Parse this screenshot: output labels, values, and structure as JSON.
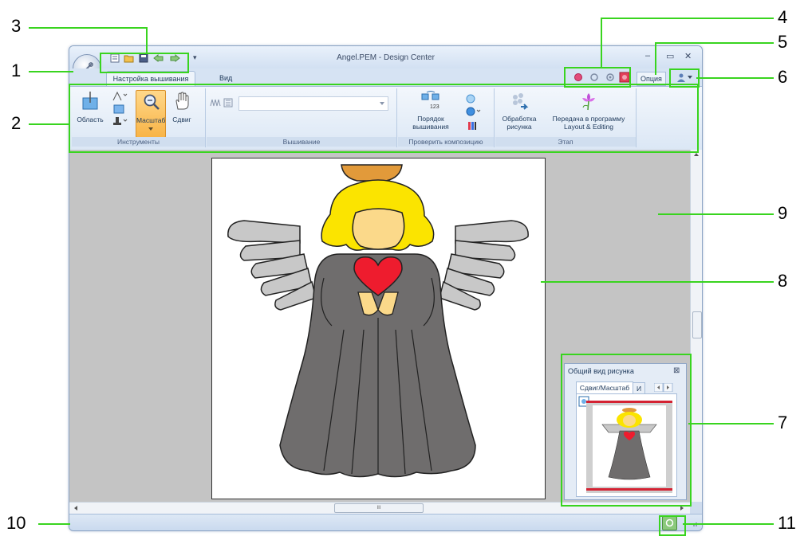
{
  "window": {
    "title": "Angel.PEM - Design Center",
    "minimize_glyph": "–",
    "maximize_glyph": "▭",
    "close_glyph": "✕"
  },
  "quick_access": {
    "more_glyph": "▾",
    "icons": [
      "new-icon",
      "open-icon",
      "save-icon",
      "undo-icon",
      "redo-icon"
    ]
  },
  "tabs": {
    "embroidery_setup": "Настройка вышивания",
    "view": "Вид",
    "option": "Опция"
  },
  "ribbon": {
    "tools": {
      "label": "Инструменты",
      "area": "Область",
      "zoom": "Масштаб",
      "pan": "Сдвиг"
    },
    "embroidery": {
      "label": "Вышивание",
      "dropdown_value": ""
    },
    "check": {
      "label": "Проверить композицию",
      "order_line1": "Порядок",
      "order_line2": "вышивания",
      "order_badge": "123"
    },
    "stage": {
      "label": "Этап",
      "process_line1": "Обработка",
      "process_line2": "рисунка",
      "transfer_line1": "Передача в программу",
      "transfer_line2": "Layout & Editing"
    }
  },
  "overview": {
    "title": "Общий вид рисунка",
    "tab_active": "Сдвиг/Масштаб",
    "tab_next": "И",
    "close_glyph": "⊠"
  },
  "scrollbar": {
    "hscroll_grip": "III"
  },
  "callouts": {
    "n1": "1",
    "n2": "2",
    "n3": "3",
    "n4": "4",
    "n5": "5",
    "n6": "6",
    "n7": "7",
    "n8": "8",
    "n9": "9",
    "n10": "10",
    "n11": "11"
  },
  "colors": {
    "callout_line": "#39d41f",
    "angel_robe": "#6f6d6d",
    "angel_hair": "#fbe400",
    "angel_halo": "#e29a3a",
    "angel_skin": "#fbd98a",
    "angel_heart": "#ee1c2e",
    "angel_wings": "#c8c8c8",
    "canvas_bg": "#c4c4c4"
  }
}
